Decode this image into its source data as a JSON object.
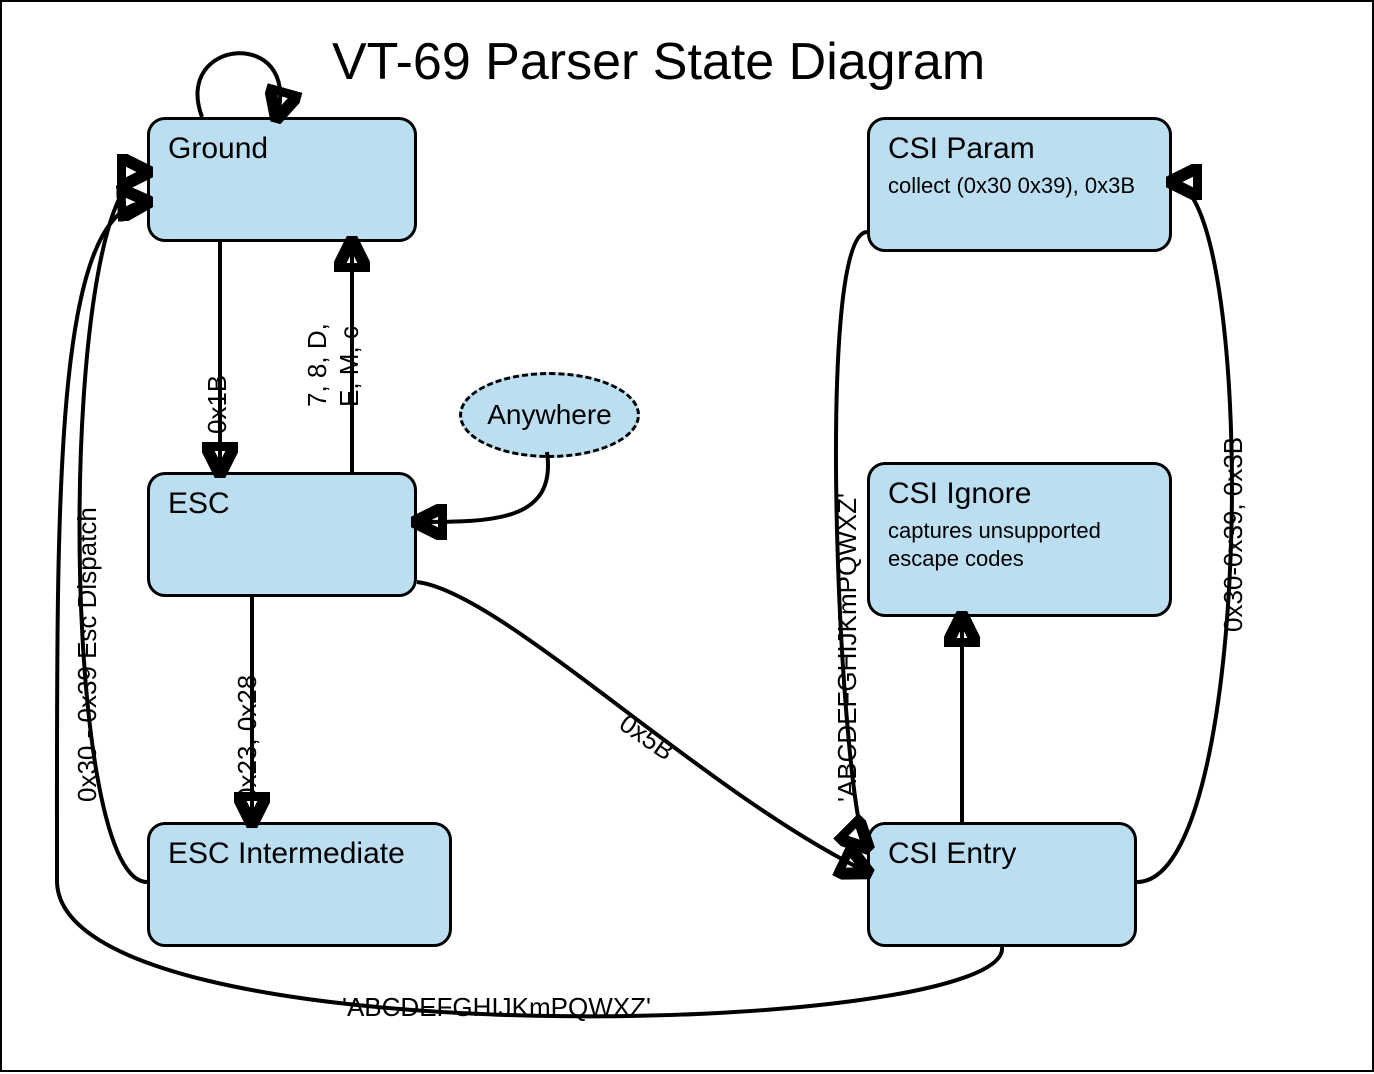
{
  "title": "VT-69 Parser State Diagram",
  "nodes": {
    "ground": {
      "label": "Ground"
    },
    "esc": {
      "label": "ESC"
    },
    "esc_inter": {
      "label": "ESC Intermediate"
    },
    "anywhere": {
      "label": "Anywhere"
    },
    "csi_param": {
      "label": "CSI Param",
      "sub": "collect (0x30 0x39), 0x3B"
    },
    "csi_ignore": {
      "label": "CSI Ignore",
      "sub": "captures unsupported escape codes"
    },
    "csi_entry": {
      "label": "CSI Entry"
    }
  },
  "edges": {
    "ground_self": "",
    "ground_to_esc": "0x1B",
    "esc_to_ground": "7, 8, D, E, M, c",
    "esc_to_esc_inter": "0x23, 0x28",
    "esc_inter_to_ground": "0x30 - 0x39  Esc Dispatch",
    "anywhere_to_esc": "",
    "esc_to_csi_entry": "0x5B",
    "csi_entry_to_ground": "'ABCDEFGHIJKmPQWXZ'",
    "csi_entry_to_csi_param": "0x30-0x39, 0x3B",
    "csi_param_to_ground": "'ABCDEFGHIJKmPQWXZ'",
    "csi_entry_to_csi_ignore": ""
  }
}
